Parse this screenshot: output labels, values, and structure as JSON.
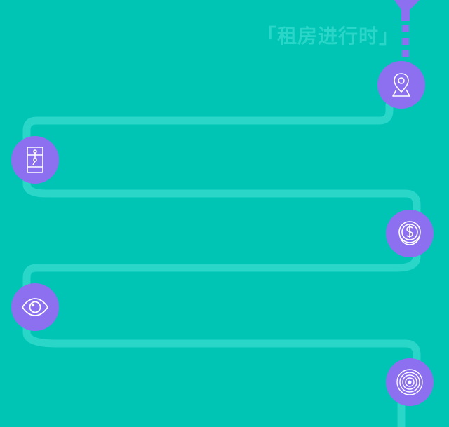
{
  "title": "「租房进行时」",
  "colors": {
    "background": "#00c4b4",
    "path": "#2ad6c8",
    "node": "#8c70f0",
    "title": "#2ad6c8",
    "icon_stroke": "#ffffff"
  },
  "steps": [
    {
      "icon": "map-pin-icon"
    },
    {
      "icon": "contract-envelope-icon"
    },
    {
      "icon": "dollar-coin-icon"
    },
    {
      "icon": "eye-icon"
    },
    {
      "icon": "target-rings-icon"
    }
  ]
}
